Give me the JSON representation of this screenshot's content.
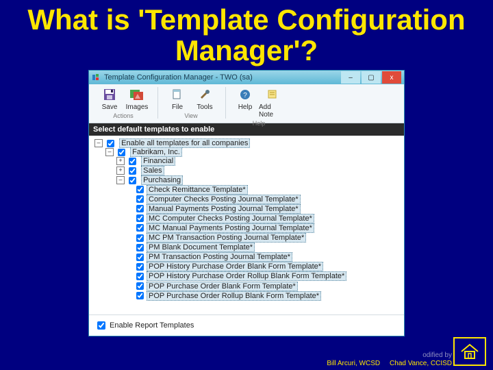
{
  "slide": {
    "title": "What is 'Template Configuration Manager'?"
  },
  "window": {
    "title": "Template Configuration Manager - TWO (sa)",
    "controls": {
      "min": "–",
      "max": "▢",
      "close": "x"
    }
  },
  "toolbar": {
    "groups": {
      "actions": {
        "label": "Actions",
        "items": {
          "save": "Save",
          "images": "Images"
        }
      },
      "view": {
        "label": "View",
        "items": {
          "file": "File",
          "tools": "Tools"
        }
      },
      "help": {
        "label": "Help",
        "items": {
          "help": "Help",
          "addnote": "Add Note"
        }
      }
    }
  },
  "section_header": "Select default templates to enable",
  "tree": {
    "root": "Enable all templates for all companies",
    "company": "Fabrikam, Inc.",
    "branches": {
      "financial": "Financial",
      "sales": "Sales",
      "purchasing": "Purchasing"
    },
    "purchasing_children": [
      "Check Remittance Template*",
      "Computer Checks Posting Journal Template*",
      "Manual Payments Posting Journal Template*",
      "MC Computer Checks Posting Journal Template*",
      "MC Manual Payments Posting Journal Template*",
      "MC PM Transaction Posting Journal Template*",
      "PM Blank Document Template*",
      "PM Transaction Posting Journal Template*",
      "POP History Purchase Order Blank Form Template*",
      "POP History Purchase Order Rollup Blank Form Template*",
      "POP Purchase Order Blank Form Template*",
      "POP Purchase Order Rollup Blank Form Template*"
    ]
  },
  "footer": {
    "enable_report_templates": "Enable Report Templates"
  },
  "credits": {
    "modified": "odified by",
    "line1": "Bill Arcuri, WCSD",
    "line2": "Chad Vance, CCISD"
  }
}
